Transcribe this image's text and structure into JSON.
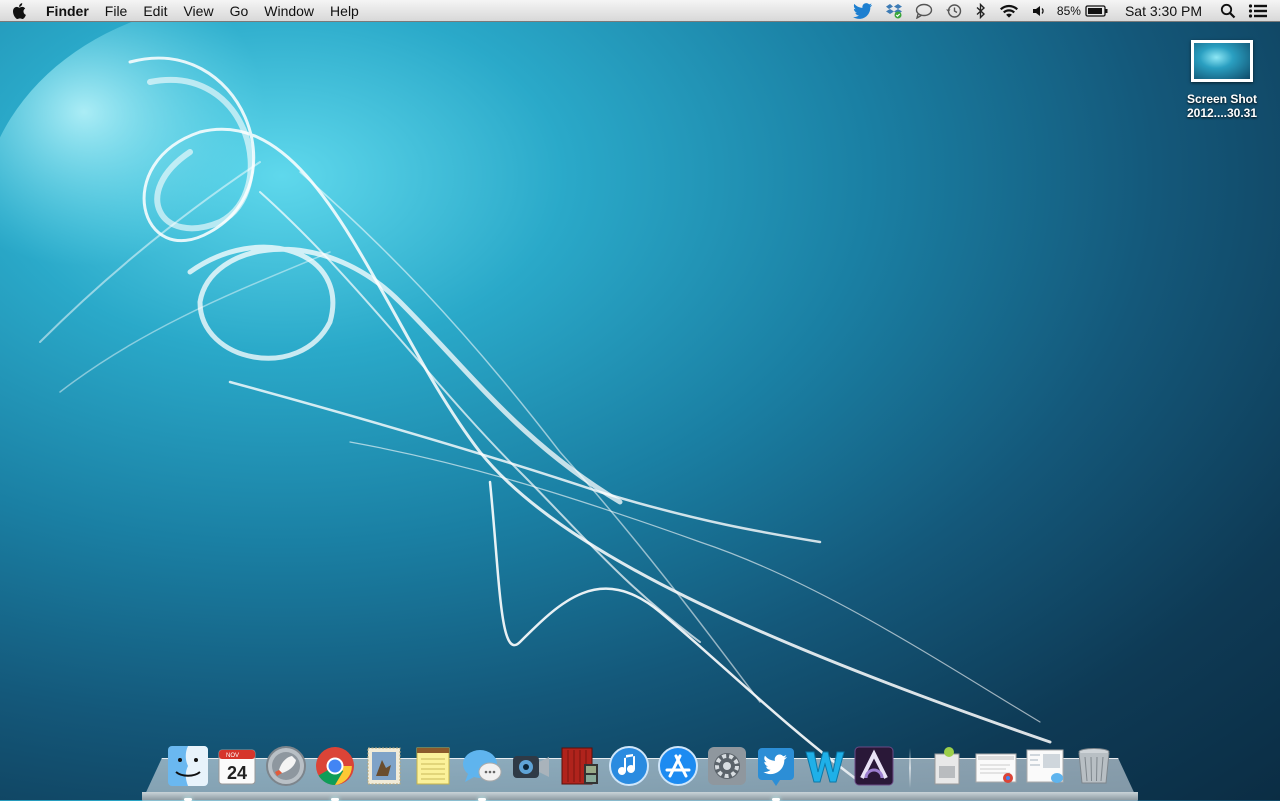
{
  "menubar": {
    "app_name": "Finder",
    "menus": [
      "File",
      "Edit",
      "View",
      "Go",
      "Window",
      "Help"
    ],
    "status": {
      "battery_percent": "85%",
      "clock": "Sat 3:30 PM"
    }
  },
  "desktop": {
    "icons": [
      {
        "line1": "Screen Shot",
        "line2": "2012....30.31"
      }
    ]
  },
  "dock": {
    "running_apps": [
      "finder",
      "chrome",
      "messages",
      "twitter"
    ],
    "calendar_day": "24",
    "calendar_month": "NOV"
  }
}
